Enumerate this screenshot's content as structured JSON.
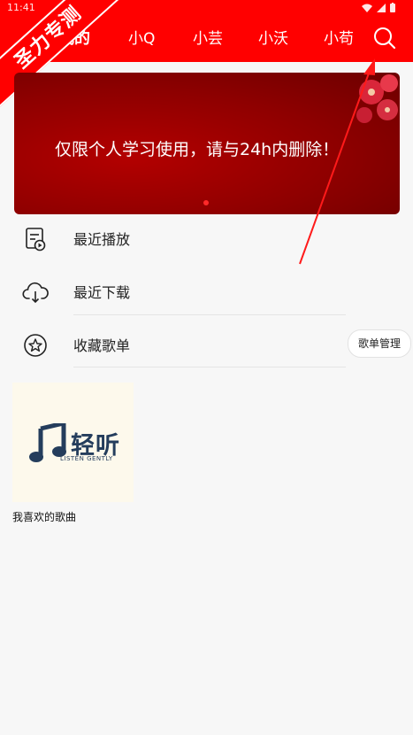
{
  "status_bar": {
    "time": "11:41"
  },
  "ribbon": {
    "text": "圣力专测"
  },
  "tabs": [
    {
      "label": "我的",
      "active": true
    },
    {
      "label": "小Q"
    },
    {
      "label": "小芸"
    },
    {
      "label": "小沃"
    },
    {
      "label": "小苟"
    }
  ],
  "banner": {
    "text": "仅限个人学习使用，请与24h内删除！",
    "page_index": 1,
    "page_count": 1
  },
  "menu": [
    {
      "label": "最近播放",
      "icon": "recent-play-icon"
    },
    {
      "label": "最近下载",
      "icon": "cloud-download-icon"
    },
    {
      "label": "收藏歌单",
      "icon": "star-icon"
    }
  ],
  "manage_button": {
    "label": "歌单管理"
  },
  "playlists": [
    {
      "name": "我喜欢的歌曲",
      "cover_title": "轻听",
      "cover_subtitle": "LISTEN GENTLY"
    }
  ],
  "colors": {
    "header_bg": "#ff0000",
    "banner_bg": "#9a0000",
    "text_primary": "#222222"
  }
}
